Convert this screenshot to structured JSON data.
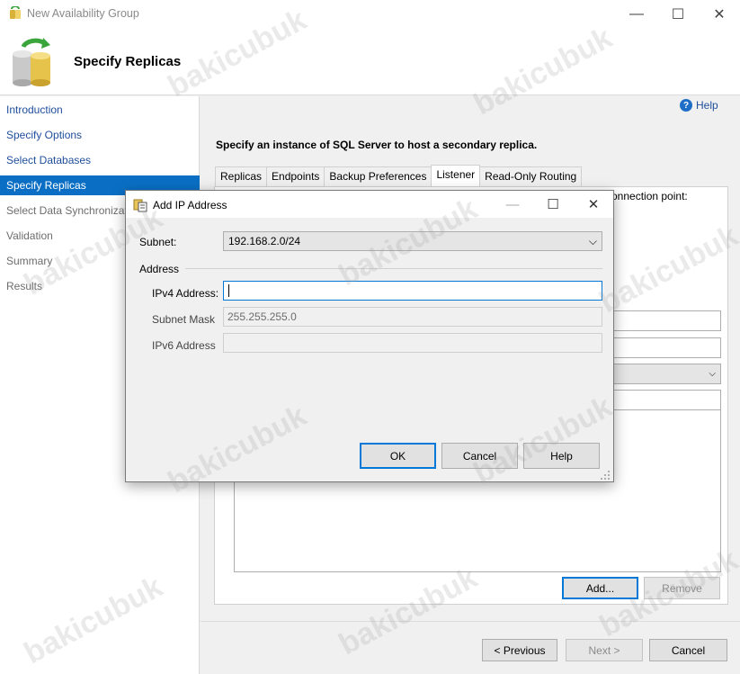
{
  "window": {
    "title": "New Availability Group",
    "minimize_glyph": "—",
    "maximize_glyph": "☐",
    "close_glyph": "✕"
  },
  "header": {
    "title": "Specify Replicas",
    "icon": "database-cylinder-icon"
  },
  "nav": {
    "items": [
      {
        "label": "Introduction",
        "state": "link"
      },
      {
        "label": "Specify Options",
        "state": "link"
      },
      {
        "label": "Select Databases",
        "state": "link"
      },
      {
        "label": "Specify Replicas",
        "state": "active"
      },
      {
        "label": "Select Data Synchronization",
        "state": "muted"
      },
      {
        "label": "Validation",
        "state": "muted"
      },
      {
        "label": "Summary",
        "state": "muted"
      },
      {
        "label": "Results",
        "state": "muted"
      }
    ]
  },
  "help": {
    "label": "Help",
    "icon": "help-circle-icon",
    "glyph": "?"
  },
  "instruction": "Specify an instance of SQL Server to host a secondary replica.",
  "tabs": [
    {
      "label": "Replicas",
      "selected": false
    },
    {
      "label": "Endpoints",
      "selected": false
    },
    {
      "label": "Backup Preferences",
      "selected": false
    },
    {
      "label": "Listener",
      "selected": true
    },
    {
      "label": "Read-Only Routing",
      "selected": false
    }
  ],
  "listener": {
    "note_fragment": "onnection point:",
    "dropdown_glyph": "⌵",
    "add_label": "Add...",
    "remove_label": "Remove"
  },
  "footer": {
    "previous_label": "< Previous",
    "next_label": "Next >",
    "cancel_label": "Cancel"
  },
  "dialog": {
    "title": "Add IP Address",
    "min_glyph": "—",
    "max_glyph": "☐",
    "close_glyph": "✕",
    "subnet_label": "Subnet:",
    "subnet_value": "192.168.2.0/24",
    "subnet_glyph": "⌵",
    "address_group_label": "Address",
    "ipv4_label": "IPv4 Address:",
    "ipv4_value": "",
    "mask_label": "Subnet Mask",
    "mask_value": "255.255.255.0",
    "ipv6_label": "IPv6 Address",
    "ipv6_value": "",
    "ok_label": "OK",
    "cancel_label": "Cancel",
    "help_label": "Help"
  },
  "watermark": "bakicubuk",
  "colors": {
    "accent": "#0a6fc4",
    "link": "#1f4e9c",
    "focus": "#0078d7"
  }
}
